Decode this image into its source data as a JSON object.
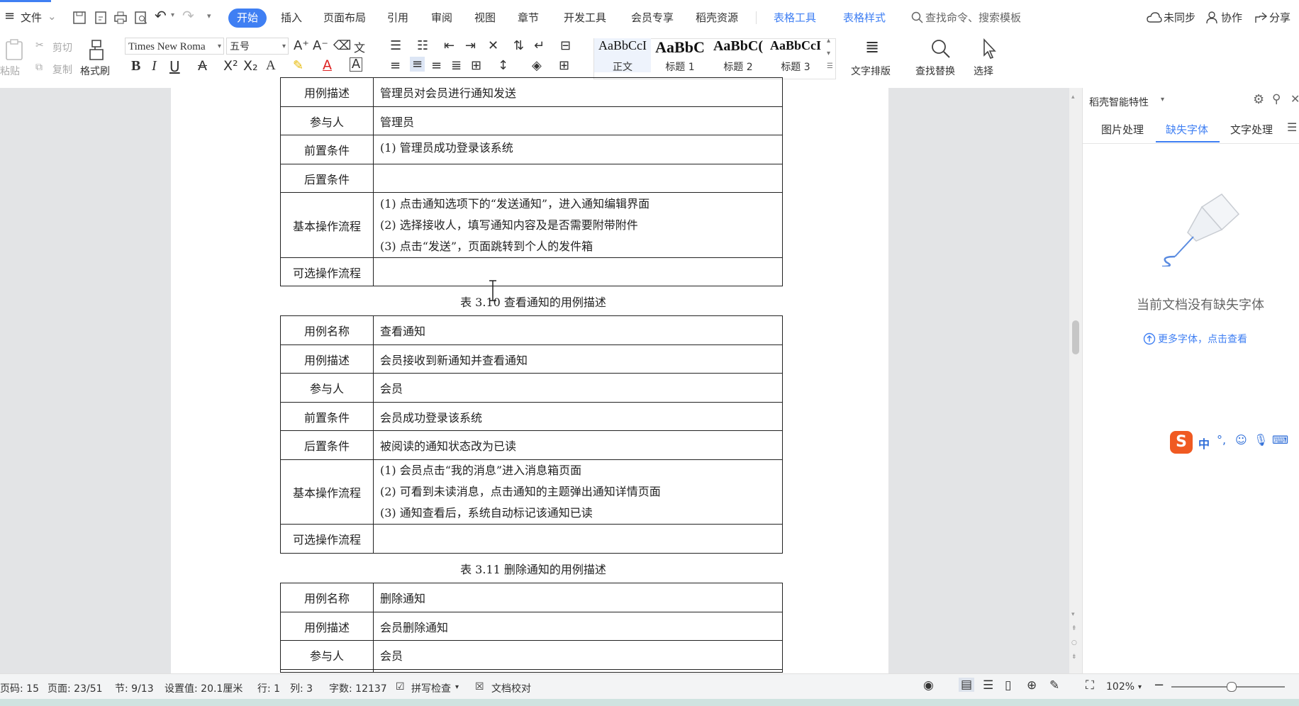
{
  "menubar": {
    "hamburger": "≡",
    "file": "文件",
    "tabs": [
      "开始",
      "插入",
      "页面布局",
      "引用",
      "审阅",
      "视图",
      "章节",
      "开发工具",
      "会员专享",
      "稻壳资源"
    ],
    "context_tabs": [
      "表格工具",
      "表格样式"
    ],
    "search_placeholder": "查找命令、搜索模板",
    "sync": "未同步",
    "collab": "协作",
    "share": "分享"
  },
  "ribbon": {
    "paste": "粘贴",
    "cut": "剪切",
    "copy": "复制",
    "format_painter": "格式刷",
    "font_name": "Times New Roma",
    "font_size": "五号",
    "styles": [
      {
        "preview": "AaBbCcI",
        "name": "正文"
      },
      {
        "preview": "AaBbC",
        "name": "标题 1"
      },
      {
        "preview": "AaBbC(",
        "name": "标题 2"
      },
      {
        "preview": "AaBbCcI",
        "name": "标题 3"
      }
    ],
    "text_layout": "文字排版",
    "find_replace": "查找替换",
    "select": "选择"
  },
  "document": {
    "table1": {
      "rows": [
        {
          "label": "用例描述",
          "value": "管理员对会员进行通知发送"
        },
        {
          "label": "参与人",
          "value": "管理员"
        },
        {
          "label": "前置条件",
          "value": "(1)   管理员成功登录该系统"
        },
        {
          "label": "后置条件",
          "value": ""
        },
        {
          "label": "基本操作流程",
          "steps": [
            "(1)   点击通知选项下的“发送通知”，进入通知编辑界面",
            "(2)   选择接收人，填写通知内容及是否需要附带附件",
            "(3)   点击“发送”，页面跳转到个人的发件箱"
          ]
        },
        {
          "label": "可选操作流程",
          "value": ""
        }
      ]
    },
    "caption2": "表 3.10  查看通知的用例描述",
    "table2": {
      "rows": [
        {
          "label": "用例名称",
          "value": "查看通知"
        },
        {
          "label": "用例描述",
          "value": "会员接收到新通知并查看通知"
        },
        {
          "label": "参与人",
          "value": "会员"
        },
        {
          "label": "前置条件",
          "value": "会员成功登录该系统"
        },
        {
          "label": "后置条件",
          "value": "被阅读的通知状态改为已读"
        },
        {
          "label": "基本操作流程",
          "steps": [
            "(1)   会员点击“我的消息”进入消息箱页面",
            "(2)   可看到未读消息，点击通知的主题弹出通知详情页面",
            "(3)   通知查看后，系统自动标记该通知已读"
          ]
        },
        {
          "label": "可选操作流程",
          "value": ""
        }
      ]
    },
    "caption3": "表 3.11  删除通知的用例描述",
    "table3": {
      "rows": [
        {
          "label": "用例名称",
          "value": "删除通知"
        },
        {
          "label": "用例描述",
          "value": "会员删除通知"
        },
        {
          "label": "参与人",
          "value": "会员"
        }
      ]
    }
  },
  "panel": {
    "title": "稻壳智能特性",
    "tabs": [
      "图片处理",
      "缺失字体",
      "文字处理"
    ],
    "active_tab": "缺失字体",
    "empty_message": "当前文档没有缺失字体",
    "more_fonts_link": "更多字体，点击查看"
  },
  "status": {
    "page_code": "页码: 15",
    "page": "页面: 23/51",
    "section": "节: 9/13",
    "setting": "设置值: 20.1厘米",
    "row": "行: 1",
    "col": "列: 3",
    "word_count": "字数: 12137",
    "spell_check": "拼写检查",
    "doc_proof": "文档校对",
    "zoom": "102%"
  },
  "ime": {
    "lang": "中"
  },
  "colors": {
    "accent": "#3f7ff3",
    "page": "#ffffff",
    "canvas": "#e3e4e6"
  }
}
